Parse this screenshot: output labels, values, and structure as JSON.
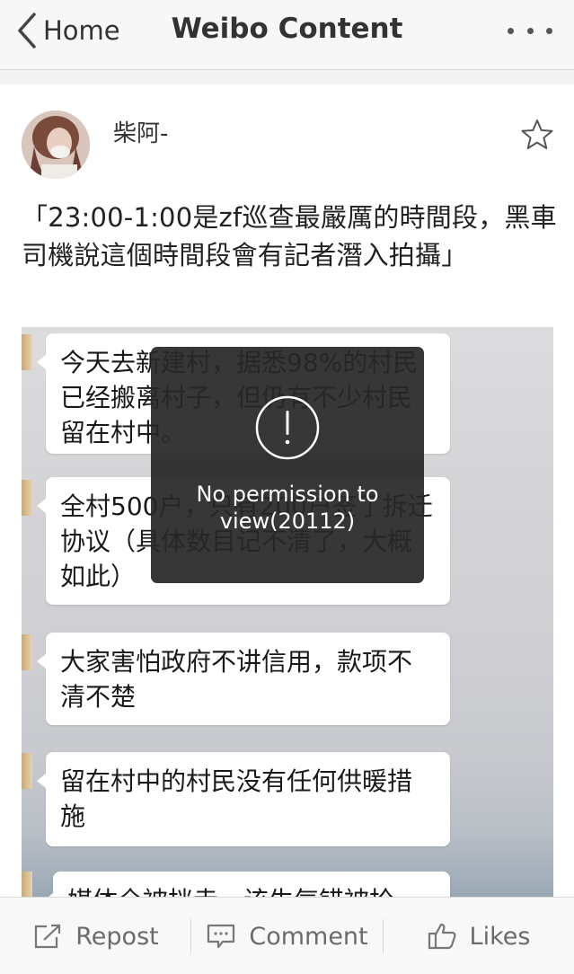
{
  "navbar": {
    "back_label": "Home",
    "title": "Weibo Content"
  },
  "post": {
    "username": "柴阿-",
    "text": "「23:00-1:00是zf巡查最嚴厲的時間段，黑車司機說這個時間段會有記者潛入拍攝」",
    "image_bubbles": [
      "今天去新建村，据悉98%的村民已经搬离村子，但仍有不少村民留在村中。",
      "全村500户，只有200户签了拆迁协议（具体数目记不清了，大概如此）",
      "大家害怕政府不讲信用，款项不清不楚",
      "留在村中的村民没有任何供暖措施",
      "媒体全被挡走，该生气错被抢"
    ]
  },
  "toast": {
    "message": "No permission to view(20112)",
    "icon": "exclamation-circle-icon"
  },
  "actions": {
    "repost_label": "Repost",
    "comment_label": "Comment",
    "likes_label": "Likes"
  },
  "colors": {
    "background": "#f2f2f2",
    "navbar": "#f7f7f7",
    "toast": "#282828",
    "action_text": "#6b6b6b"
  }
}
